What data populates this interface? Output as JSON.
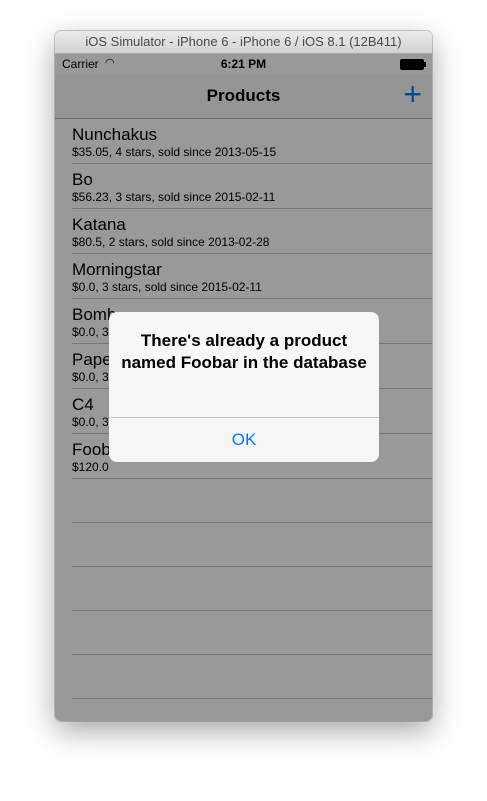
{
  "window": {
    "title": "iOS Simulator - iPhone 6 - iPhone 6 / iOS 8.1 (12B411)"
  },
  "statusbar": {
    "carrier": "Carrier",
    "wifi_icon": "wifi-icon",
    "time": "6:21 PM",
    "battery_icon": "battery-icon"
  },
  "navbar": {
    "title": "Products",
    "add_label": "+"
  },
  "products": [
    {
      "name": "Nunchakus",
      "detail": "$35.05, 4 stars, sold since 2013-05-15"
    },
    {
      "name": "Bo",
      "detail": "$56.23, 3 stars, sold since 2015-02-11"
    },
    {
      "name": "Katana",
      "detail": "$80.5, 2 stars, sold since 2013-02-28"
    },
    {
      "name": "Morningstar",
      "detail": "$0.0, 3 stars, sold since 2015-02-11"
    },
    {
      "name": "Bomb",
      "detail": "$0.0, 3"
    },
    {
      "name": "Pape",
      "detail": "$0.0, 3"
    },
    {
      "name": "C4",
      "detail": "$0.0, 3"
    },
    {
      "name": "Foob",
      "detail": "$120.0"
    }
  ],
  "alert": {
    "message": "There's already a product named Foobar in the database",
    "ok_label": "OK"
  },
  "colors": {
    "tint": "#007aff",
    "separator": "#c8c7cc",
    "dim": "rgba(0,0,0,0.40)"
  }
}
